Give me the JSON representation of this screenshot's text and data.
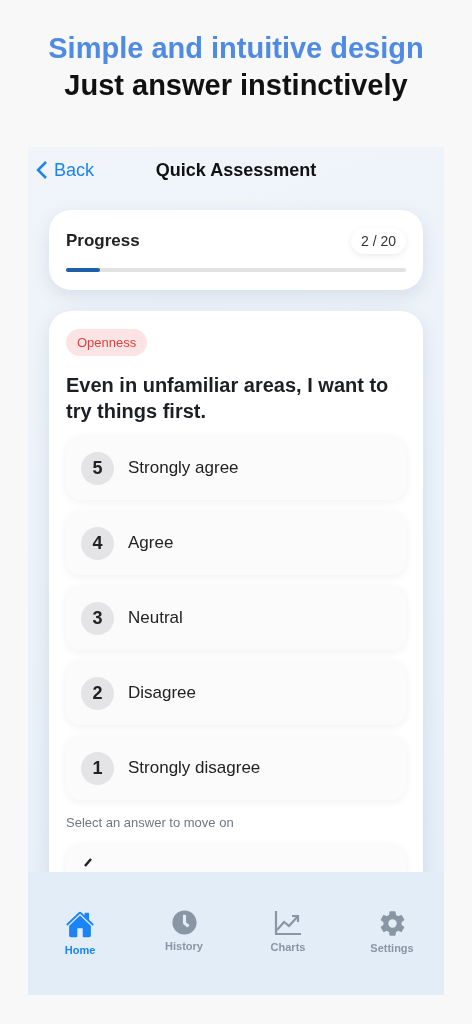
{
  "headline": {
    "title": "Simple and intuitive design",
    "subtitle": "Just answer instinctively"
  },
  "nav": {
    "back": "Back",
    "title": "Quick Assessment"
  },
  "progress": {
    "label": "Progress",
    "count": "2 / 20",
    "level": 0.1
  },
  "question": {
    "tag": "Openness",
    "text": "Even in unfamiliar areas, I want to try things first.",
    "answers": [
      {
        "number": "5",
        "label": "Strongly agree",
        "selected": false
      },
      {
        "number": "4",
        "label": "Agree",
        "selected": false
      },
      {
        "number": "3",
        "label": "Neutral",
        "selected": false
      },
      {
        "number": "2",
        "label": "Disagree",
        "selected": false
      },
      {
        "number": "1",
        "label": "Strongly disagree",
        "selected": false
      }
    ],
    "hint": "Select an answer to move on"
  },
  "tabs": [
    {
      "kind": "home",
      "label": "Home",
      "selected": true
    },
    {
      "kind": "history",
      "label": "History",
      "selected": false
    },
    {
      "kind": "charts",
      "label": "Charts",
      "selected": false
    },
    {
      "kind": "settings",
      "label": "Settings",
      "selected": false
    }
  ]
}
